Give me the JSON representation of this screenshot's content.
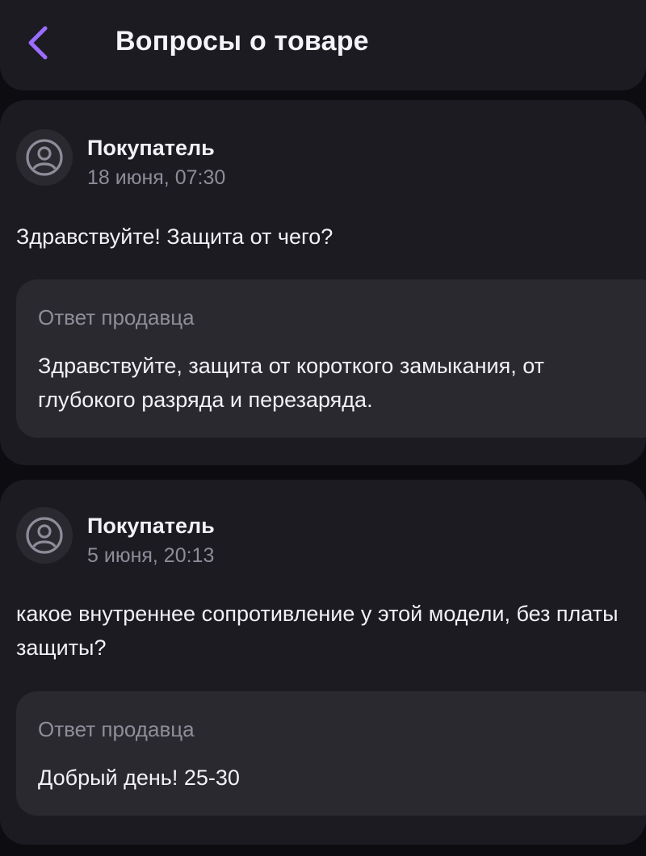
{
  "header": {
    "title": "Вопросы о товаре",
    "back_icon": "chevron-left-icon",
    "accent_color": "#9b6dff"
  },
  "questions": [
    {
      "author": "Покупатель",
      "date": "18 июня, 07:30",
      "text": "Здравствуйте! Защита от чего?",
      "answer": {
        "label": "Ответ продавца",
        "text": "Здравствуйте, защита от короткого замыкания, от глубокого разряда и перезаряда."
      }
    },
    {
      "author": "Покупатель",
      "date": "5 июня, 20:13",
      "text": "какое внутреннее сопротивление у этой модели, без платы защиты?",
      "answer": {
        "label": "Ответ продавца",
        "text": "Добрый день! 25-30"
      }
    }
  ]
}
